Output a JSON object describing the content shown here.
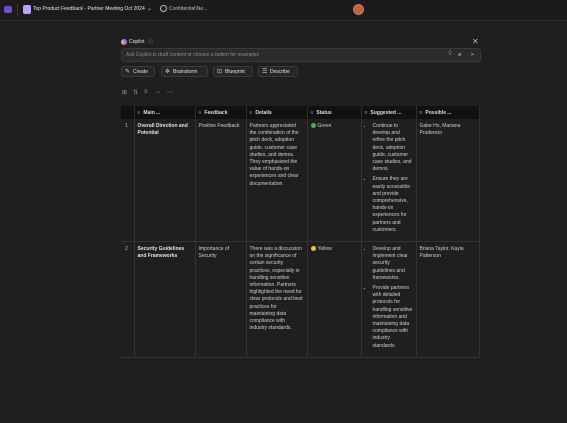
{
  "app": {
    "doc_title": "Top Product Feedback - Partner Meeting Oct 2024",
    "chevron": "⌄",
    "sensitivity": "Confidential\\Ne..."
  },
  "copilot": {
    "title": "Copilot",
    "info_icon": "ⓘ",
    "close": "✕",
    "ask_placeholder": "Ask Copilot to draft content or choose a button for examples",
    "buttons": [
      {
        "label": "Create",
        "icon": "✎"
      },
      {
        "label": "Brainstorm",
        "icon": "✲"
      },
      {
        "label": "Blueprint",
        "icon": "⊡"
      },
      {
        "label": "Describe",
        "icon": "☰"
      }
    ]
  },
  "toolbar": {
    "icons": [
      "⊞",
      "⇅",
      "≡",
      "↔",
      "⋯"
    ]
  },
  "table": {
    "headers": [
      "Main ...",
      "Feedback",
      "Details",
      "Status",
      "Suggested ...",
      "Possible ..."
    ],
    "rows": [
      {
        "num": "1",
        "main": "Overall Direction and Potential",
        "feedback": "Positive Feedback",
        "details": "Partners appreciated the combination of the pitch deck, adoption guide, customer case studies, and demos. They emphasized the value of hands-on experiences and clear documentation.",
        "status": "Green",
        "status_color": "#4caf50",
        "suggested": [
          "Continue to develop and refine the pitch deck, adoption guide, customer case studies, and demos.",
          "Ensure they are easily accessible and provide comprehensive, hands-on experiences for partners and customers."
        ],
        "possible": "Gabe Ho, Mariana Prudencio"
      },
      {
        "num": "2",
        "main": "Security Guidelines and Frameworks",
        "feedback": "Importance of Security",
        "details": "There was a discussion on the significance of certain security practices, especially in handling sensitive information. Partners highlighted the need for clear protocols and best practices for maintaining data compliance with industry standards.",
        "status": "Yellow",
        "status_color": "#f2c12e",
        "suggested": [
          "Develop and implement clear security guidelines and frameworks.",
          "Provide partners with detailed protocols for handling sensitive information and maintaining data compliance with industry standards."
        ],
        "possible": "Briana Taylor, Kayla Patterson"
      }
    ]
  }
}
